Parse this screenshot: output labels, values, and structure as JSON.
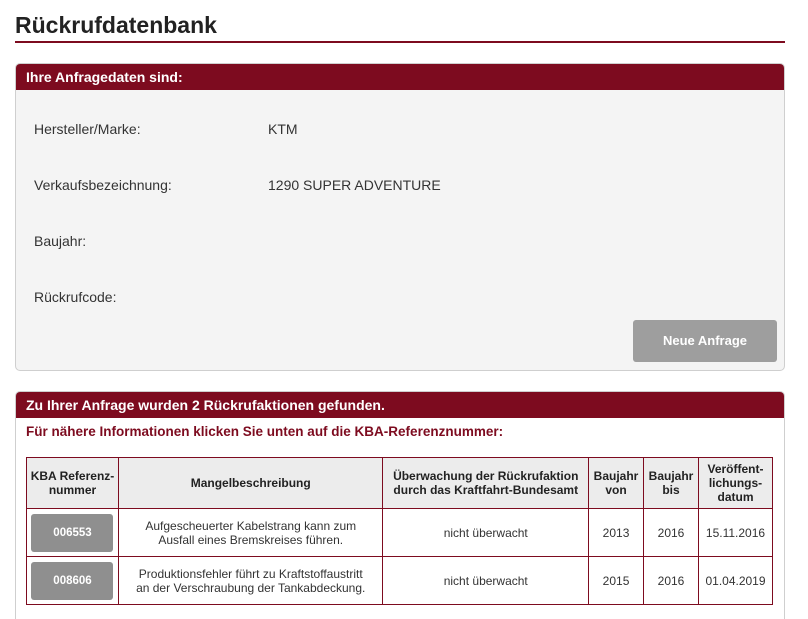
{
  "page_title": "Rückrufdatenbank",
  "query": {
    "header": "Ihre Anfragedaten sind:",
    "rows": [
      {
        "label": "Hersteller/Marke:",
        "value": "KTM"
      },
      {
        "label": "Verkaufsbezeichnung:",
        "value": "1290 SUPER ADVENTURE"
      },
      {
        "label": "Baujahr:",
        "value": ""
      },
      {
        "label": "Rückrufcode:",
        "value": ""
      }
    ],
    "new_query_label": "Neue Anfrage"
  },
  "results": {
    "header": "Zu Ihrer Anfrage wurden 2 Rückrufaktionen gefunden.",
    "instruction": "Für nähere Informationen klicken Sie unten auf die KBA-Referenznummer:",
    "columns": {
      "ref": [
        "KBA Referenz-",
        "nummer"
      ],
      "defect": [
        "Mangelbeschreibung"
      ],
      "monitoring": [
        "Überwachung der Rückrufaktion",
        "durch das Kraftfahrt-Bundesamt"
      ],
      "year_from": [
        "Baujahr",
        "von"
      ],
      "year_to": [
        "Baujahr",
        "bis"
      ],
      "published": [
        "Veröffent-",
        "lichungs-",
        "datum"
      ]
    },
    "rows": [
      {
        "ref": "006553",
        "defect": [
          "Aufgescheuerter Kabelstrang kann zum",
          "Ausfall eines Bremskreises führen."
        ],
        "monitoring": "nicht überwacht",
        "year_from": "2013",
        "year_to": "2016",
        "published": "15.11.2016"
      },
      {
        "ref": "008606",
        "defect": [
          "Produktionsfehler führt zu Kraftstoffaustritt",
          "an der Verschraubung der Tankabdeckung."
        ],
        "monitoring": "nicht überwacht",
        "year_from": "2015",
        "year_to": "2016",
        "published": "01.04.2019"
      }
    ]
  }
}
